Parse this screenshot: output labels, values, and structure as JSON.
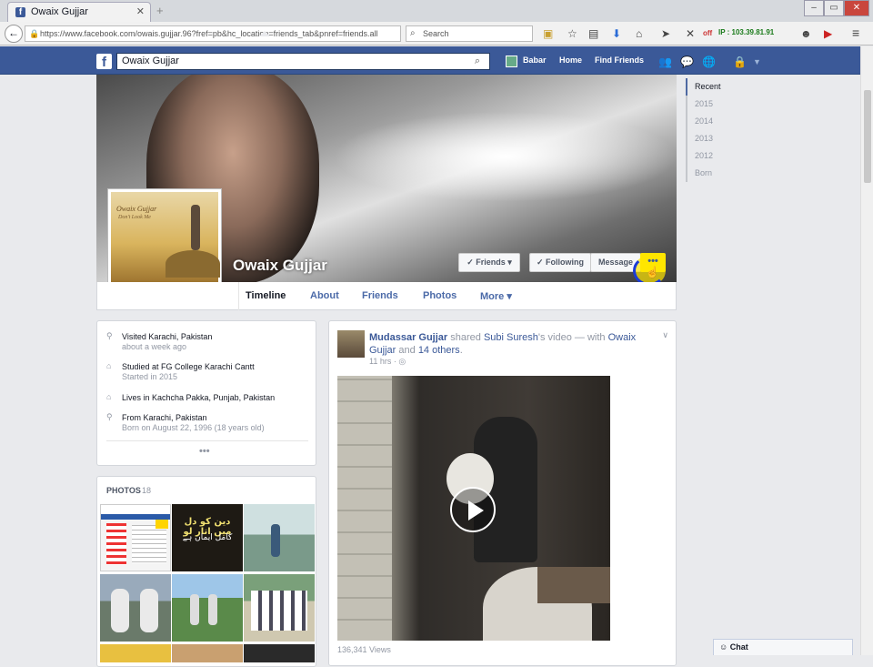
{
  "browser": {
    "tab_title": "Owaix Gujjar",
    "tab_favicon": "f",
    "tab_close": "✕",
    "new_tab": "+",
    "window_minimize": "‒",
    "window_restore": "▭",
    "window_close": "✕",
    "back": "←",
    "url": "https://www.facebook.com/owais.gujjar.96?fref=pb&hc_location=friends_tab&pnref=friends.all",
    "search_placeholder": "Search",
    "ip_label": "IP : 103.39.81.91",
    "off_label": "off"
  },
  "fb_header": {
    "logo": "f",
    "search_value": "Owaix Gujjar",
    "user_name": "Babar",
    "home": "Home",
    "find_friends": "Find Friends",
    "brand_color": "#3b5998"
  },
  "cover": {
    "profile_name": "Owaix Gujjar",
    "profile_pic_title": "Owaix Gujjar",
    "profile_pic_subtitle": "Don't Look Me",
    "friends_btn": "✓ Friends ▾",
    "following_btn": "✓ Following",
    "message_btn": "Message",
    "more_btn": "•••"
  },
  "tabs": [
    {
      "label": "Timeline"
    },
    {
      "label": "About"
    },
    {
      "label": "Friends"
    },
    {
      "label": "Photos"
    },
    {
      "label": "More ▾"
    }
  ],
  "timeline_years": [
    "Recent",
    "2015",
    "2014",
    "2013",
    "2012",
    "Born"
  ],
  "intro": {
    "rows": [
      {
        "icon": "map-pin-icon",
        "text": "Visited Karachi, Pakistan",
        "sub": "about a week ago"
      },
      {
        "icon": "school-icon",
        "text": "Studied at FG College Karachi Cantt",
        "sub": "Started in 2015"
      },
      {
        "icon": "home-icon",
        "text": "Lives in Kachcha Pakka, Punjab, Pakistan",
        "sub": ""
      },
      {
        "icon": "map-pin-icon",
        "text": "From Karachi, Pakistan",
        "sub": "Born on August 22, 1996 (18 years old)"
      }
    ],
    "more": "•••"
  },
  "photos": {
    "header": "PHOTOS",
    "count": "18",
    "urdu_caption": "دین کو دل میں اتار لو",
    "urdu_caption2": "کامل ایمان ہے"
  },
  "post": {
    "author": "Mudassar Gujjar",
    "shared_text": " shared ",
    "shared_of": "Subi Suresh",
    "video_word": "'s video — with ",
    "tagged": "Owaix Gujjar",
    "and_text": " and ",
    "others": "14 others",
    "period": ".",
    "time": "11 hrs",
    "privacy_sep": "·",
    "views": "136,341 Views"
  },
  "chat": {
    "label": "Chat"
  }
}
